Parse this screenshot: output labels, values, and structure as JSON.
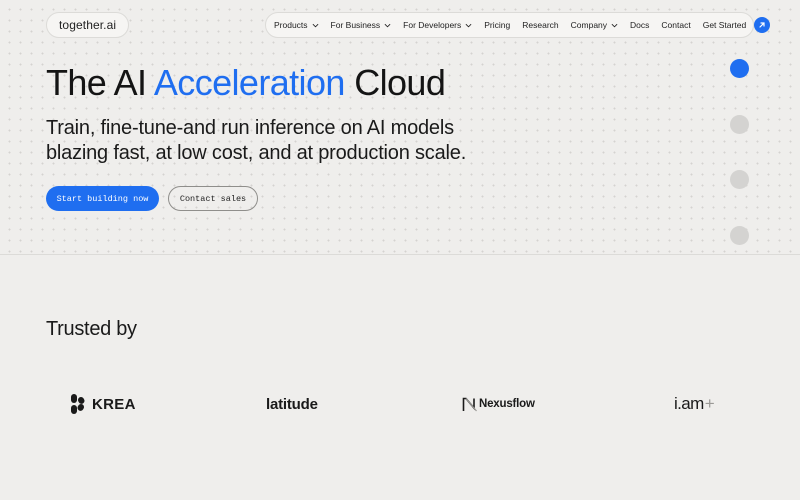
{
  "header": {
    "logo": "together.ai",
    "nav": [
      {
        "label": "Products",
        "dropdown": true
      },
      {
        "label": "For Business",
        "dropdown": true
      },
      {
        "label": "For Developers",
        "dropdown": true
      },
      {
        "label": "Pricing",
        "dropdown": false
      },
      {
        "label": "Research",
        "dropdown": false
      },
      {
        "label": "Company",
        "dropdown": true
      },
      {
        "label": "Docs",
        "dropdown": false
      },
      {
        "label": "Contact",
        "dropdown": false
      }
    ],
    "cta_label": "Get Started",
    "cta_icon": "arrow-up-right-icon"
  },
  "hero": {
    "title_pre": "The AI ",
    "title_accent": "Acceleration",
    "title_post": " Cloud",
    "subtitle": "Train, fine-tune-and run inference on AI models blazing fast, at low cost, and at production scale.",
    "primary_button": "Start building now",
    "secondary_button": "Contact sales",
    "carousel": {
      "count": 4,
      "active_index": 0
    }
  },
  "trusted": {
    "heading": "Trusted by",
    "logos": [
      {
        "name": "KREA",
        "icon": "krea-logo-icon"
      },
      {
        "name": "latitude"
      },
      {
        "name": "Nexusflow",
        "icon": "nexusflow-logo-icon"
      },
      {
        "name": "i.am",
        "suffix": "+"
      }
    ]
  },
  "colors": {
    "accent": "#1f6ef0",
    "background": "#efeeec",
    "dot_inactive": "#d4d3d1"
  }
}
